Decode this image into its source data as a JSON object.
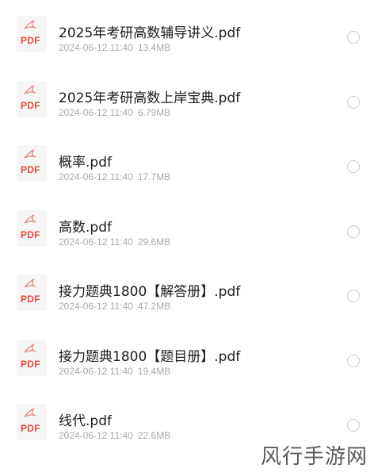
{
  "files": [
    {
      "name": "2025年考研高数辅导讲义.pdf",
      "date": "2024-06-12 11:40",
      "size": "13.4MB"
    },
    {
      "name": "2025年考研高数上岸宝典.pdf",
      "date": "2024-06-12 11:40",
      "size": "6.79MB"
    },
    {
      "name": "概率.pdf",
      "date": "2024-06-12 11:40",
      "size": "17.7MB"
    },
    {
      "name": "高数.pdf",
      "date": "2024-06-12 11:40",
      "size": "29.6MB"
    },
    {
      "name": "接力题典1800【解答册】.pdf",
      "date": "2024-06-12 11:40",
      "size": "47.2MB"
    },
    {
      "name": "接力题典1800【题目册】.pdf",
      "date": "2024-06-12 11:40",
      "size": "19.4MB"
    },
    {
      "name": "线代.pdf",
      "date": "2024-06-12 11:40",
      "size": "22.6MB"
    }
  ],
  "file_icon": {
    "label": "PDF",
    "icon": "pdf-file-icon",
    "accent": "#e44a3c"
  },
  "selection": {
    "icon": "radio-unchecked-icon"
  },
  "watermark": "风行手游网"
}
